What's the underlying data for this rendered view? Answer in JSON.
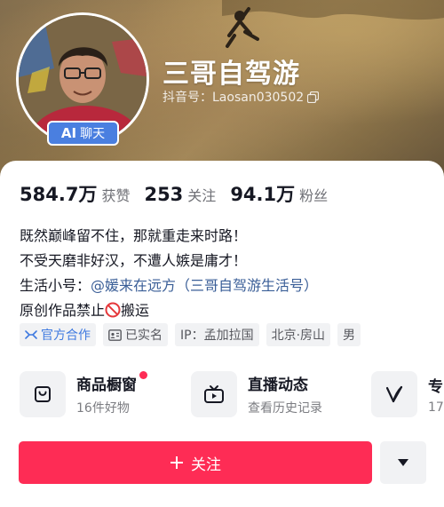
{
  "profile": {
    "nickname": "三哥自驾游",
    "douyin_id": "抖音号：Laosan030502",
    "ai_badge": {
      "ai": "AI",
      "label": "聊天"
    }
  },
  "stats": [
    {
      "value": "584.7万",
      "label": "获赞"
    },
    {
      "value": "253",
      "label": "关注"
    },
    {
      "value": "94.1万",
      "label": "粉丝"
    }
  ],
  "bio": {
    "line1": "既然巅峰留不住，那就重走来时路！",
    "line2": "不受天磨非好汉，不遭人嫉是庸才！",
    "line3_prefix": "生活小号：",
    "line3_mention": "@媛来在远方（三哥自驾游生活号）",
    "line4_prefix": "原创作品禁止",
    "line4_suffix": "搬运"
  },
  "tags": {
    "official": "官方合作",
    "verified": "已实名",
    "ip": "IP：孟加拉国",
    "location": "北京·房山",
    "gender": "男"
  },
  "features": [
    {
      "title": "商品橱窗",
      "subtitle": "16件好物",
      "icon": "cart-icon",
      "has_dot": true
    },
    {
      "title": "直播动态",
      "subtitle": "查看历史记录",
      "icon": "tv-icon",
      "has_dot": false
    },
    {
      "title": "专",
      "subtitle": "17",
      "icon": "v-icon",
      "has_dot": false
    }
  ],
  "actions": {
    "follow_label": "关注",
    "more_icon": "triangle-down-icon"
  },
  "colors": {
    "accent": "#fe2c55",
    "ai_badge": "#4a7fe0",
    "mention": "#3a5e97",
    "official": "#3f7ae0"
  }
}
